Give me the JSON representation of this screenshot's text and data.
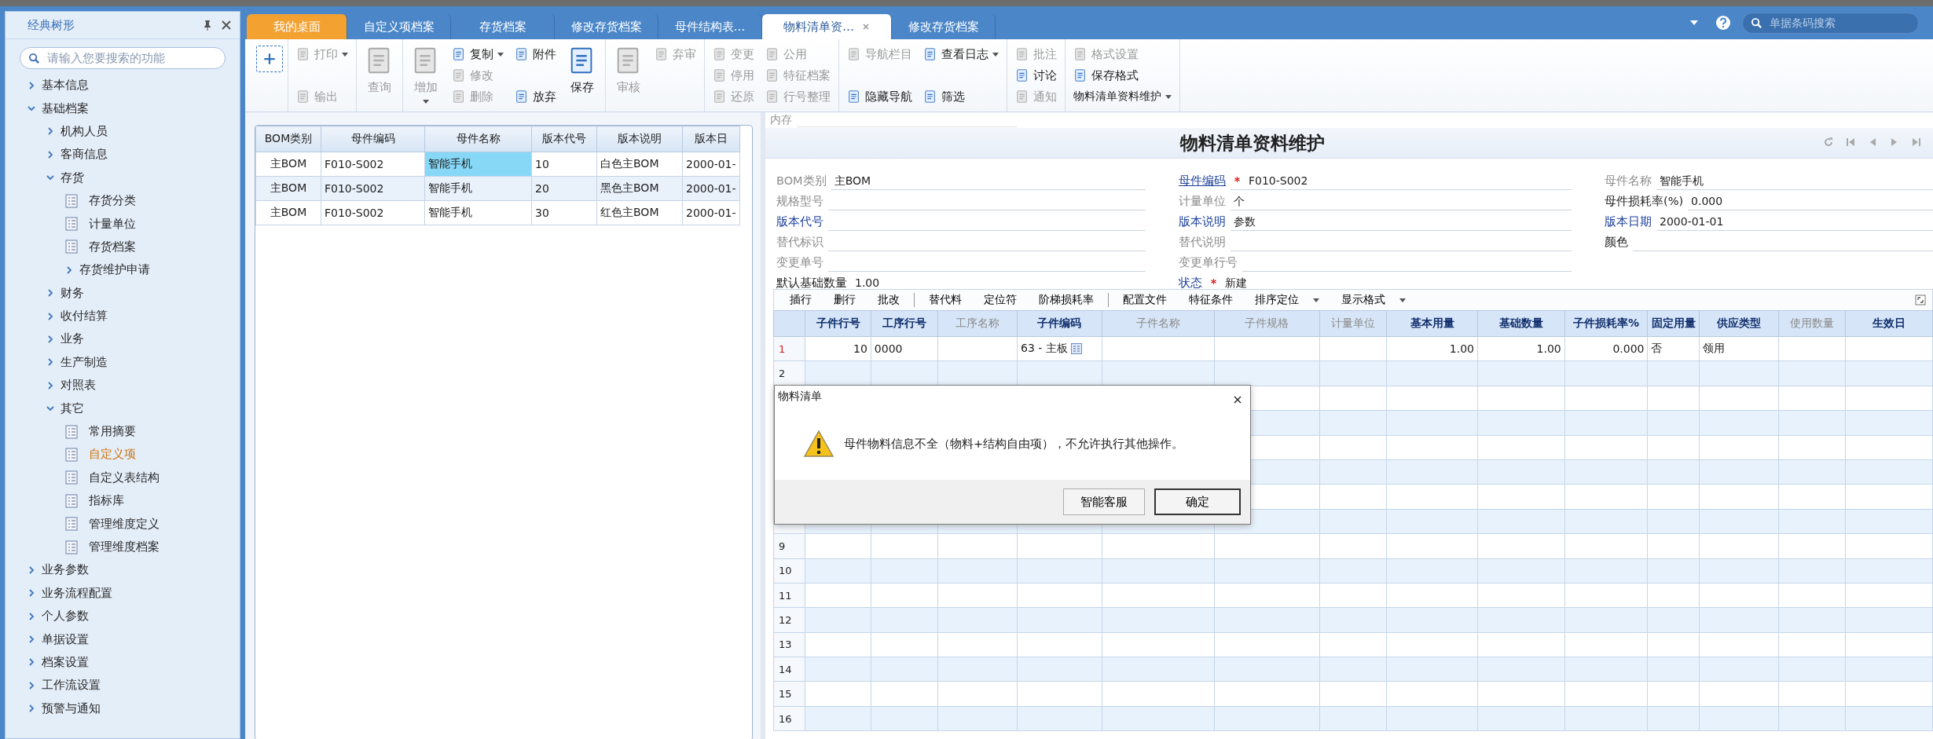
{
  "header": {
    "tabs": [
      {
        "label": "我的桌面",
        "kind": "home",
        "selected": false,
        "closable": false
      },
      {
        "label": "自定义项档案",
        "kind": "doc",
        "selected": false,
        "closable": false
      },
      {
        "label": "存货档案",
        "kind": "doc",
        "selected": false,
        "closable": false
      },
      {
        "label": "修改存货档案",
        "kind": "doc",
        "selected": false,
        "closable": false
      },
      {
        "label": "母件结构表…",
        "kind": "doc",
        "selected": false,
        "closable": false
      },
      {
        "label": "物料清单资…",
        "kind": "doc",
        "selected": true,
        "closable": true
      },
      {
        "label": "修改存货档案",
        "kind": "doc",
        "selected": false,
        "closable": false
      }
    ],
    "search": {
      "placeholder": "单据条码搜索"
    }
  },
  "sidebar": {
    "title": "经典树形",
    "search": {
      "placeholder": "请输入您要搜索的功能"
    },
    "tree": [
      {
        "label": "基本信息",
        "kind": "folder",
        "expanded": false,
        "selected": false
      },
      {
        "label": "基础档案",
        "kind": "folder",
        "expanded": true,
        "selected": false,
        "children": [
          {
            "label": "机构人员",
            "kind": "folder",
            "expanded": false,
            "selected": false
          },
          {
            "label": "客商信息",
            "kind": "folder",
            "expanded": false,
            "selected": false
          },
          {
            "label": "存货",
            "kind": "folder",
            "expanded": true,
            "selected": false,
            "children": [
              {
                "label": "存货分类",
                "kind": "page",
                "selected": false
              },
              {
                "label": "计量单位",
                "kind": "page",
                "selected": false
              },
              {
                "label": "存货档案",
                "kind": "page",
                "selected": false
              },
              {
                "label": "存货维护申请",
                "kind": "folder",
                "expanded": false,
                "selected": false
              }
            ]
          },
          {
            "label": "财务",
            "kind": "folder",
            "expanded": false,
            "selected": false
          },
          {
            "label": "收付结算",
            "kind": "folder",
            "expanded": false,
            "selected": false
          },
          {
            "label": "业务",
            "kind": "folder",
            "expanded": false,
            "selected": false
          },
          {
            "label": "生产制造",
            "kind": "folder",
            "expanded": false,
            "selected": false
          },
          {
            "label": "对照表",
            "kind": "folder",
            "expanded": false,
            "selected": false
          },
          {
            "label": "其它",
            "kind": "folder",
            "expanded": true,
            "selected": false,
            "children": [
              {
                "label": "常用摘要",
                "kind": "page",
                "selected": false
              },
              {
                "label": "自定义项",
                "kind": "page",
                "selected": true
              },
              {
                "label": "自定义表结构",
                "kind": "page",
                "selected": false
              },
              {
                "label": "指标库",
                "kind": "page",
                "selected": false
              },
              {
                "label": "管理维度定义",
                "kind": "page",
                "selected": false
              },
              {
                "label": "管理维度档案",
                "kind": "page",
                "selected": false
              }
            ]
          }
        ]
      },
      {
        "label": "业务参数",
        "kind": "folder",
        "expanded": false,
        "selected": false
      },
      {
        "label": "业务流程配置",
        "kind": "folder",
        "expanded": false,
        "selected": false
      },
      {
        "label": "个人参数",
        "kind": "folder",
        "expanded": false,
        "selected": false
      },
      {
        "label": "单据设置",
        "kind": "folder",
        "expanded": false,
        "selected": false
      },
      {
        "label": "档案设置",
        "kind": "folder",
        "expanded": false,
        "selected": false
      },
      {
        "label": "工作流设置",
        "kind": "folder",
        "expanded": false,
        "selected": false
      },
      {
        "label": "预警与通知",
        "kind": "folder",
        "expanded": false,
        "selected": false
      }
    ]
  },
  "toolbar": [
    {
      "columns": [
        [
          {
            "kind": "new"
          }
        ]
      ]
    },
    {
      "columns": [
        [
          {
            "kind": "small",
            "label": "打印",
            "disabled": true,
            "dropdown": true
          },
          {
            "kind": "small",
            "label": "输出",
            "disabled": true,
            "dropdown": false
          }
        ]
      ]
    },
    {
      "columns": [
        [
          {
            "kind": "large",
            "label": "查询",
            "disabled": true,
            "dropdown": false
          }
        ]
      ]
    },
    {
      "columns": [
        [
          {
            "kind": "large",
            "label": "增加",
            "disabled": true,
            "dropdown": true
          }
        ],
        [
          {
            "kind": "small",
            "label": "复制",
            "disabled": false,
            "dropdown": true
          },
          {
            "kind": "small",
            "label": "修改",
            "disabled": true,
            "dropdown": false
          },
          {
            "kind": "small",
            "label": "删除",
            "disabled": true,
            "dropdown": false
          }
        ],
        [
          {
            "kind": "small",
            "label": "附件",
            "disabled": false,
            "dropdown": false
          },
          {
            "kind": "small",
            "label": "放弃",
            "disabled": false,
            "dropdown": false
          }
        ],
        [
          {
            "kind": "large",
            "label": "保存",
            "disabled": false,
            "dropdown": false
          }
        ]
      ]
    },
    {
      "columns": [
        [
          {
            "kind": "large",
            "label": "审核",
            "disabled": true,
            "dropdown": false
          }
        ],
        [
          {
            "kind": "small",
            "label": "弃审",
            "disabled": true,
            "dropdown": false
          }
        ]
      ]
    },
    {
      "columns": [
        [
          {
            "kind": "small",
            "label": "变更",
            "disabled": true,
            "dropdown": false
          },
          {
            "kind": "small",
            "label": "停用",
            "disabled": true,
            "dropdown": false
          },
          {
            "kind": "small",
            "label": "还原",
            "disabled": true,
            "dropdown": false
          }
        ],
        [
          {
            "kind": "small",
            "label": "公用",
            "disabled": true,
            "dropdown": false
          },
          {
            "kind": "small",
            "label": "特征档案",
            "disabled": true,
            "dropdown": false
          },
          {
            "kind": "small",
            "label": "行号整理",
            "disabled": true,
            "dropdown": false
          }
        ]
      ]
    },
    {
      "columns": [
        [
          {
            "kind": "small",
            "label": "导航栏目",
            "disabled": true,
            "dropdown": false
          },
          {
            "kind": "small",
            "label": "隐藏导航",
            "disabled": false,
            "dropdown": false
          }
        ],
        [
          {
            "kind": "small",
            "label": "查看日志",
            "disabled": false,
            "dropdown": true
          },
          {
            "kind": "small",
            "label": "筛选",
            "disabled": false,
            "dropdown": false
          }
        ]
      ]
    },
    {
      "columns": [
        [
          {
            "kind": "small",
            "label": "批注",
            "disabled": true,
            "dropdown": false
          },
          {
            "kind": "small",
            "label": "讨论",
            "disabled": false,
            "dropdown": false
          },
          {
            "kind": "small",
            "label": "通知",
            "disabled": true,
            "dropdown": false
          }
        ]
      ]
    },
    {
      "columns": [
        [
          {
            "kind": "small",
            "label": "格式设置",
            "disabled": true,
            "dropdown": false
          },
          {
            "kind": "small",
            "label": "保存格式",
            "disabled": false,
            "dropdown": false
          },
          {
            "kind": "text",
            "label": "物料清单资料维护",
            "disabled": false,
            "dropdown": true
          }
        ]
      ]
    }
  ],
  "bom_list": {
    "columns": [
      "BOM类别",
      "母件编码",
      "母件名称",
      "版本代号",
      "版本说明",
      "版本日"
    ],
    "rows": [
      {
        "cells": [
          {
            "text": "主BOM",
            "selected": false
          },
          {
            "text": "F010-S002",
            "selected": false
          },
          {
            "text": "智能手机",
            "selected": true
          },
          {
            "text": "10",
            "selected": false
          },
          {
            "text": "白色主BOM",
            "selected": false
          },
          {
            "text": "2000-01-",
            "selected": false
          }
        ]
      },
      {
        "cells": [
          {
            "text": "主BOM",
            "selected": false
          },
          {
            "text": "F010-S002",
            "selected": false
          },
          {
            "text": "智能手机",
            "selected": false
          },
          {
            "text": "20",
            "selected": false
          },
          {
            "text": "黑色主BOM",
            "selected": false
          },
          {
            "text": "2000-01-",
            "selected": false
          }
        ]
      },
      {
        "cells": [
          {
            "text": "主BOM",
            "selected": false
          },
          {
            "text": "F010-S002",
            "selected": false
          },
          {
            "text": "智能手机",
            "selected": false
          },
          {
            "text": "30",
            "selected": false
          },
          {
            "text": "红色主BOM",
            "selected": false
          },
          {
            "text": "2000-01-",
            "selected": false
          }
        ]
      }
    ]
  },
  "form": {
    "memo_label": "内存",
    "title": "物料清单资料维护",
    "columns": [
      [
        {
          "label": "BOM类别",
          "kind": "muted",
          "required": false,
          "value": "主BOM"
        },
        {
          "label": "规格型号",
          "kind": "muted",
          "required": false
        },
        {
          "label": "版本代号",
          "kind": "link",
          "required": false
        },
        {
          "label": "替代标识",
          "kind": "muted",
          "required": false
        },
        {
          "label": "变更单号",
          "kind": "muted",
          "required": false
        },
        {
          "label": "默认基础数量",
          "kind": "plain",
          "required": false,
          "value": "1.00"
        }
      ],
      [
        {
          "label": "母件编码",
          "kind": "underlined",
          "required": true,
          "value": "F010-S002"
        },
        {
          "label": "计量单位",
          "kind": "muted",
          "required": false,
          "value": "个"
        },
        {
          "label": "版本说明",
          "kind": "link",
          "required": false,
          "value": "参数"
        },
        {
          "label": "替代说明",
          "kind": "muted",
          "required": false
        },
        {
          "label": "变更单行号",
          "kind": "muted",
          "required": false
        },
        {
          "label": "状态",
          "kind": "link",
          "required": true,
          "value": "新建"
        }
      ],
      [
        {
          "label": "母件名称",
          "kind": "muted",
          "required": false,
          "value": "智能手机"
        },
        {
          "label": "母件损耗率(%)",
          "kind": "plain",
          "required": false,
          "value": "0.000"
        },
        {
          "label": "版本日期",
          "kind": "link",
          "required": false,
          "value": "2000-01-01"
        },
        {
          "label": "颜色",
          "kind": "plain",
          "required": false
        }
      ]
    ]
  },
  "grid": {
    "actions": [
      [
        {
          "label": "插行",
          "dropdown": false
        },
        {
          "label": "删行",
          "dropdown": false
        },
        {
          "label": "批改",
          "dropdown": false
        }
      ],
      [
        {
          "label": "替代料",
          "dropdown": false
        },
        {
          "label": "定位符",
          "dropdown": false
        },
        {
          "label": "阶梯损耗率",
          "dropdown": false
        }
      ],
      [
        {
          "label": "配置文件",
          "dropdown": false
        },
        {
          "label": "特征条件",
          "dropdown": false
        },
        {
          "label": "排序定位",
          "dropdown": true
        },
        {
          "label": "显示格式",
          "dropdown": true
        }
      ]
    ],
    "columns": [
      {
        "label": "子件行号",
        "editable": true,
        "kind": "number"
      },
      {
        "label": "工序行号",
        "editable": true,
        "kind": "text"
      },
      {
        "label": "工序名称",
        "editable": false,
        "kind": "text"
      },
      {
        "label": "子件编码",
        "editable": true,
        "kind": "ref"
      },
      {
        "label": "子件名称",
        "editable": false,
        "kind": "text"
      },
      {
        "label": "子件规格",
        "editable": false,
        "kind": "text"
      },
      {
        "label": "计量单位",
        "editable": false,
        "kind": "text"
      },
      {
        "label": "基本用量",
        "editable": true,
        "kind": "number"
      },
      {
        "label": "基础数量",
        "editable": true,
        "kind": "number"
      },
      {
        "label": "子件损耗率%",
        "editable": true,
        "kind": "number"
      },
      {
        "label": "固定用量",
        "editable": true,
        "kind": "text"
      },
      {
        "label": "供应类型",
        "editable": true,
        "kind": "text"
      },
      {
        "label": "使用数量",
        "editable": false,
        "kind": "number"
      },
      {
        "label": "生效日",
        "editable": true,
        "kind": "text"
      }
    ],
    "rows": [
      {
        "number": "1",
        "current": true,
        "cells": [
          "10",
          "0000",
          null,
          "63 - 主板",
          null,
          null,
          null,
          "1.00",
          "1.00",
          "0.000",
          "否",
          "领用"
        ]
      },
      {
        "number": "2",
        "current": false
      },
      {},
      {},
      {},
      {},
      {},
      {},
      {
        "number": "9",
        "current": false
      },
      {
        "number": "10",
        "current": false
      },
      {
        "number": "11",
        "current": false
      },
      {
        "number": "12",
        "current": false
      },
      {
        "number": "13",
        "current": false
      },
      {
        "number": "14",
        "current": false
      },
      {
        "number": "15",
        "current": false
      },
      {
        "number": "16",
        "current": false
      }
    ]
  },
  "dialog": {
    "title": "物料清单",
    "message": "母件物料信息不全（物料+结构自由项），不允许执行其他操作。",
    "buttons": [
      {
        "label": "智能客服",
        "default": false
      },
      {
        "label": "确定",
        "default": true
      }
    ]
  }
}
